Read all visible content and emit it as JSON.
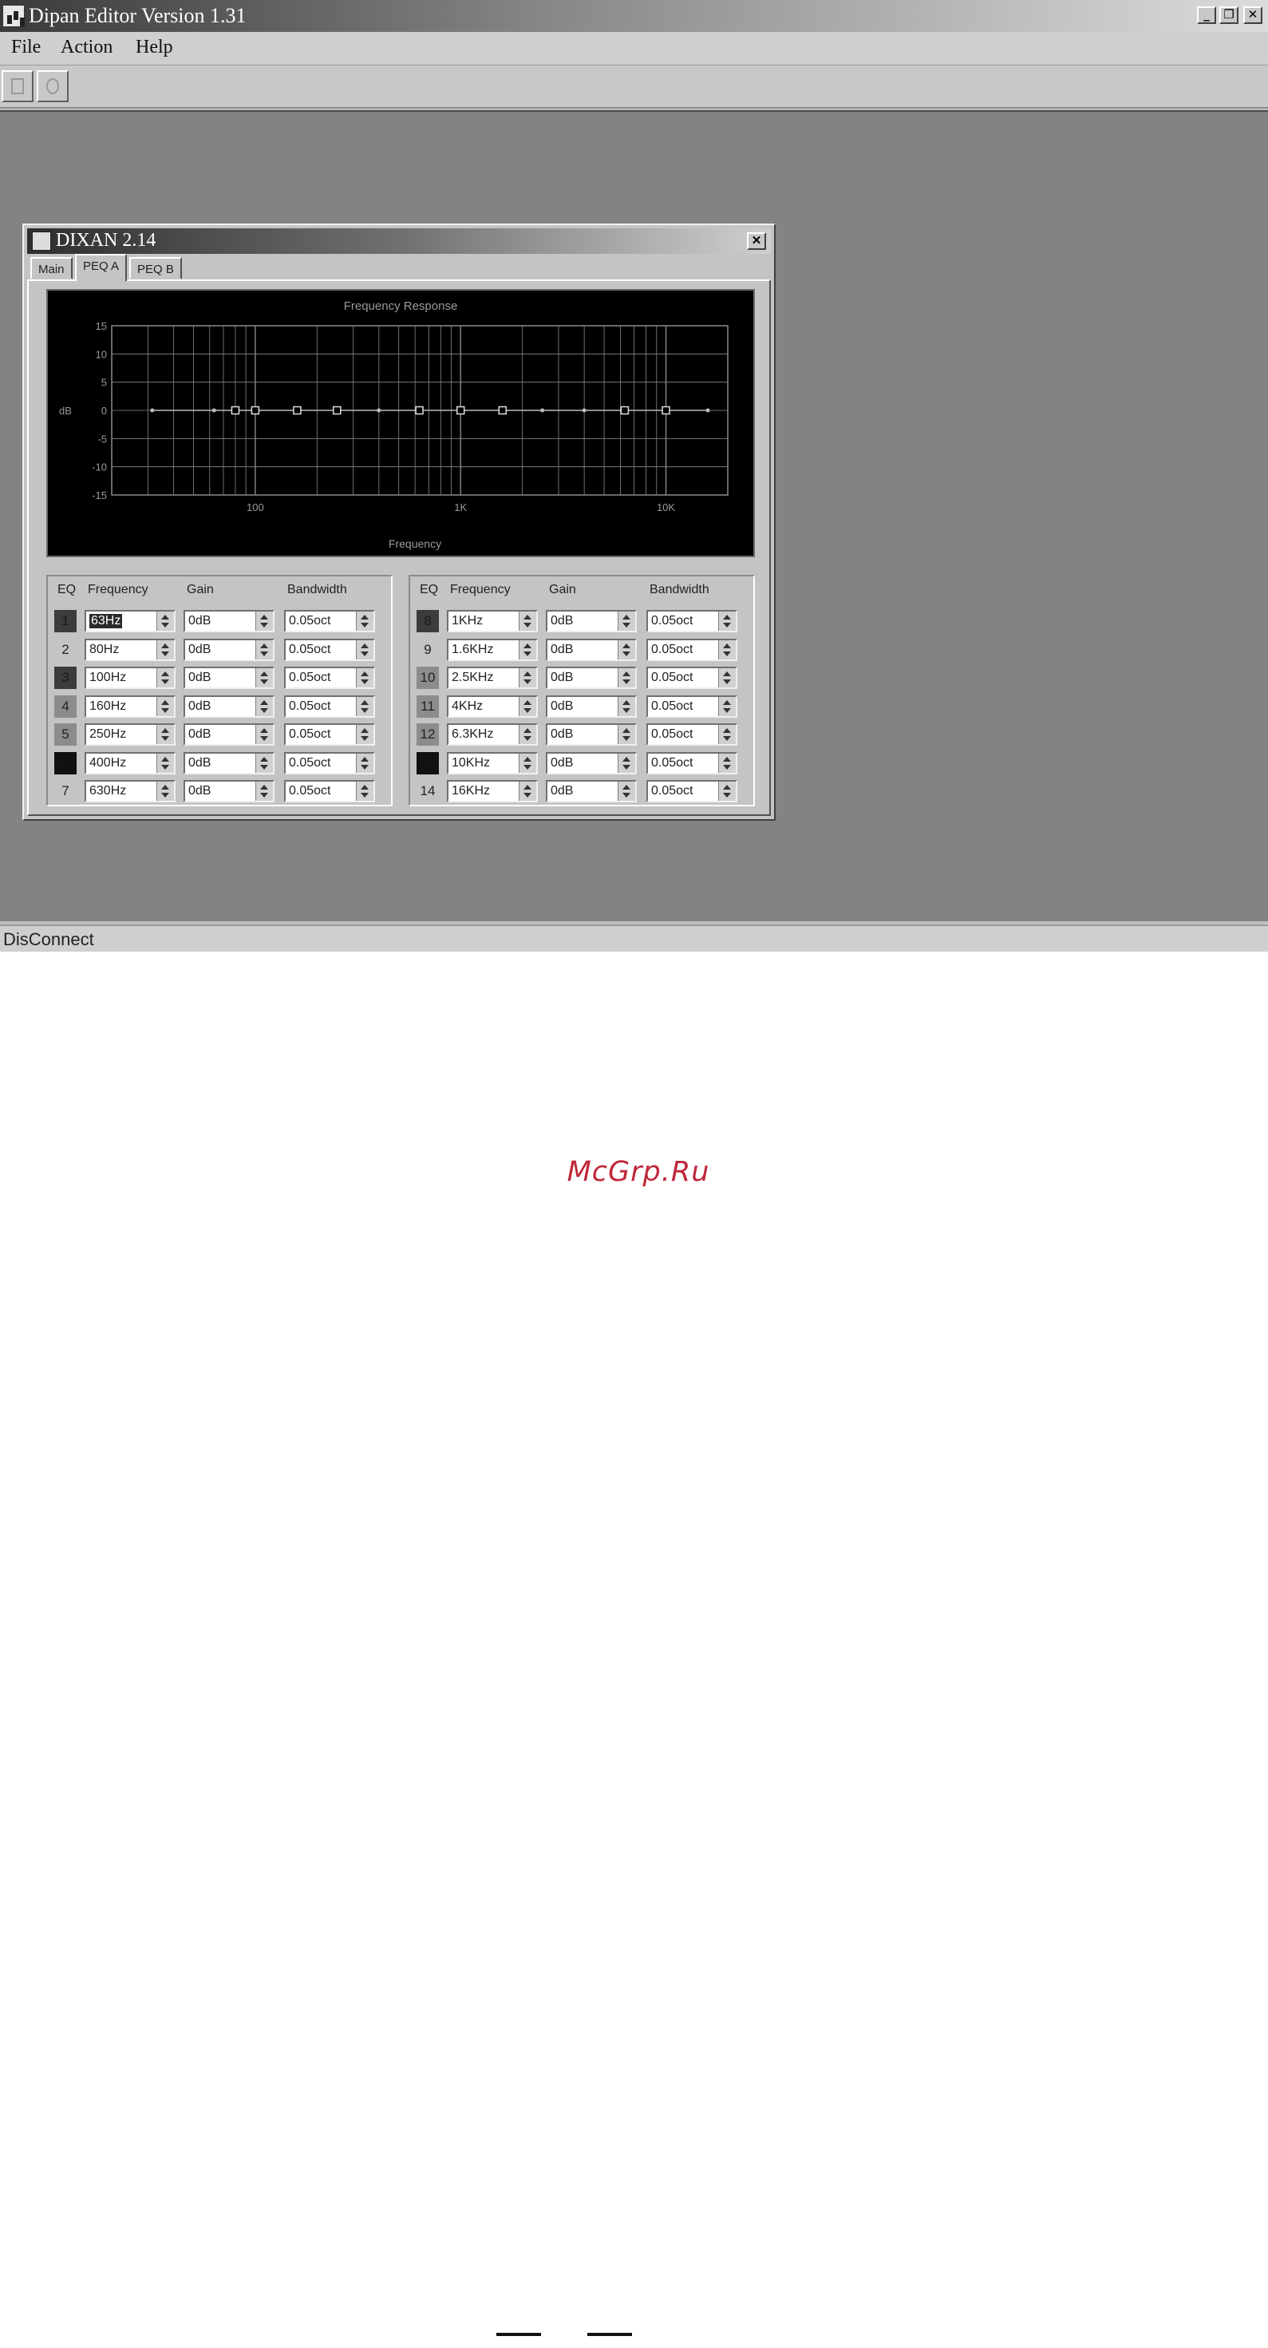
{
  "app": {
    "title": "Dipan Editor Version  1.31",
    "caption_buttons": {
      "minimize": "_",
      "restore": "❐",
      "close": "✕"
    }
  },
  "menu": {
    "items": [
      "File",
      "Action",
      "Help"
    ]
  },
  "toolbar": {
    "icons": [
      "new-document-icon",
      "connect-icon"
    ]
  },
  "child_window": {
    "title": "DIXAN 2.14",
    "close": "✕",
    "tabs": [
      {
        "label": "Main",
        "active": false
      },
      {
        "label": "PEQ A",
        "active": true
      },
      {
        "label": "PEQ B",
        "active": false
      }
    ]
  },
  "chart_data": {
    "type": "line",
    "title": "Frequency Response",
    "xlabel": "Frequency",
    "ylabel": "dB",
    "x_scale": "log",
    "xlim": [
      20,
      20000
    ],
    "ylim": [
      -15,
      15
    ],
    "y_ticks": [
      "15",
      "10",
      "5",
      "0",
      "-5",
      "-10",
      "-15"
    ],
    "x_tick_labels": [
      {
        "value": 100,
        "label": "100"
      },
      {
        "value": 1000,
        "label": "1K"
      },
      {
        "value": 10000,
        "label": "10K"
      }
    ],
    "grid": true,
    "series": [
      {
        "x": [
          31.5,
          63,
          80,
          100,
          160,
          250,
          400,
          630,
          1000,
          1600,
          2500,
          4000,
          6300,
          10000,
          16000
        ],
        "y": [
          0,
          0,
          0,
          0,
          0,
          0,
          0,
          0,
          0,
          0,
          0,
          0,
          0,
          0,
          0
        ]
      }
    ],
    "markers": [
      {
        "x": 80,
        "y": 0
      },
      {
        "x": 100,
        "y": 0
      },
      {
        "x": 160,
        "y": 0
      },
      {
        "x": 250,
        "y": 0
      },
      {
        "x": 630,
        "y": 0
      },
      {
        "x": 1000,
        "y": 0
      },
      {
        "x": 1600,
        "y": 0
      },
      {
        "x": 6300,
        "y": 0
      },
      {
        "x": 10000,
        "y": 0
      }
    ]
  },
  "eq": {
    "headers": {
      "eq": "EQ",
      "frequency": "Frequency",
      "gain": "Gain",
      "bandwidth": "Bandwidth"
    },
    "left": [
      {
        "num": "1",
        "style": "dark",
        "frequency": "63Hz",
        "gain": "0dB",
        "bandwidth": "0.05oct",
        "selected": true
      },
      {
        "num": "2",
        "style": "plain",
        "frequency": "80Hz",
        "gain": "0dB",
        "bandwidth": "0.05oct"
      },
      {
        "num": "3",
        "style": "dark",
        "frequency": "100Hz",
        "gain": "0dB",
        "bandwidth": "0.05oct"
      },
      {
        "num": "4",
        "style": "mid",
        "frequency": "160Hz",
        "gain": "0dB",
        "bandwidth": "0.05oct"
      },
      {
        "num": "5",
        "style": "mid",
        "frequency": "250Hz",
        "gain": "0dB",
        "bandwidth": "0.05oct"
      },
      {
        "num": "6",
        "style": "black",
        "frequency": "400Hz",
        "gain": "0dB",
        "bandwidth": "0.05oct"
      },
      {
        "num": "7",
        "style": "plain",
        "frequency": "630Hz",
        "gain": "0dB",
        "bandwidth": "0.05oct"
      }
    ],
    "right": [
      {
        "num": "8",
        "style": "dark",
        "frequency": "1KHz",
        "gain": "0dB",
        "bandwidth": "0.05oct"
      },
      {
        "num": "9",
        "style": "plain",
        "frequency": "1.6KHz",
        "gain": "0dB",
        "bandwidth": "0.05oct"
      },
      {
        "num": "10",
        "style": "mid",
        "frequency": "2.5KHz",
        "gain": "0dB",
        "bandwidth": "0.05oct"
      },
      {
        "num": "11",
        "style": "mid",
        "frequency": "4KHz",
        "gain": "0dB",
        "bandwidth": "0.05oct"
      },
      {
        "num": "12",
        "style": "mid",
        "frequency": "6.3KHz",
        "gain": "0dB",
        "bandwidth": "0.05oct"
      },
      {
        "num": "13",
        "style": "black",
        "frequency": "10KHz",
        "gain": "0dB",
        "bandwidth": "0.05oct"
      },
      {
        "num": "14",
        "style": "plain",
        "frequency": "16KHz",
        "gain": "0dB",
        "bandwidth": "0.05oct"
      }
    ]
  },
  "status": {
    "text": "DisConnect"
  },
  "watermark": {
    "text": "McGrp.Ru"
  },
  "colors": {
    "graph_bg": "#000000",
    "grid": "#8a8a8a",
    "curve": "#bdbdbd",
    "watermark": "#c0273a"
  }
}
